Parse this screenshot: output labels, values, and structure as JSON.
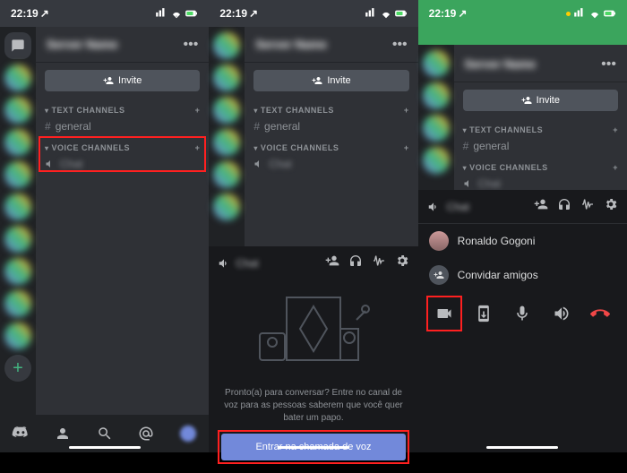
{
  "status": {
    "time": "22:19",
    "arrow": "↗"
  },
  "server": {
    "name_blurred": "Server Name",
    "menu": "•••"
  },
  "invite": {
    "label": "Invite"
  },
  "text_channels": {
    "header": "TEXT CHANNELS",
    "items": [
      {
        "name": "general"
      }
    ]
  },
  "voice_channels": {
    "header": "VOICE CHANNELS",
    "items": [
      {
        "name": "Chat"
      }
    ],
    "members": [
      {
        "name": "Ronaldo Gogoni"
      }
    ]
  },
  "voice_prompt": {
    "text": "Pronto(a) para conversar? Entre no canal de voz para as pessoas saberem que você quer bater um papo.",
    "join": "Entrar na chamada de voz"
  },
  "connected_panel": {
    "channel": "Chat",
    "members": [
      {
        "name": "Ronaldo Gogoni"
      }
    ],
    "invite_friends": "Convidar amigos"
  }
}
